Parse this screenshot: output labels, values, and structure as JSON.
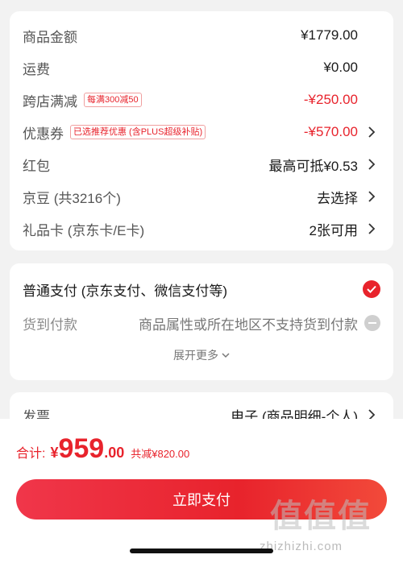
{
  "cost": {
    "items": [
      {
        "label": "商品金额",
        "value": "¥1779.00"
      },
      {
        "label": "运费",
        "value": "¥0.00"
      },
      {
        "label": "跨店满减",
        "tag": "每满300减50",
        "value": "-¥250.00"
      },
      {
        "label": "优惠券",
        "tag": "已选推荐优惠 (含PLUS超级补贴)",
        "value": "-¥570.00"
      },
      {
        "label": "红包",
        "value": "最高可抵¥0.53"
      },
      {
        "label": "京豆 (共3216个)",
        "value": "去选择"
      },
      {
        "label": "礼品卡 (京东卡/E卡)",
        "value": "2张可用"
      }
    ]
  },
  "payment": {
    "online": "普通支付 (京东支付、微信支付等)",
    "cod_label": "货到付款",
    "cod_note": "商品属性或所在地区不支持货到付款",
    "expand": "展开更多"
  },
  "invoice": {
    "label": "发票",
    "value": "电子 (商品明细-个人)"
  },
  "summary": {
    "total_label": "合计:",
    "currency": "¥",
    "total_int": "959",
    "total_dec": ".00",
    "saving": "共减¥820.00"
  },
  "action": {
    "pay_label": "立即支付"
  },
  "watermark": {
    "text": "值值值",
    "url": "zhizhizhi.com"
  },
  "colors": {
    "accent": "#e8232c",
    "background": "#f2f2f2"
  }
}
